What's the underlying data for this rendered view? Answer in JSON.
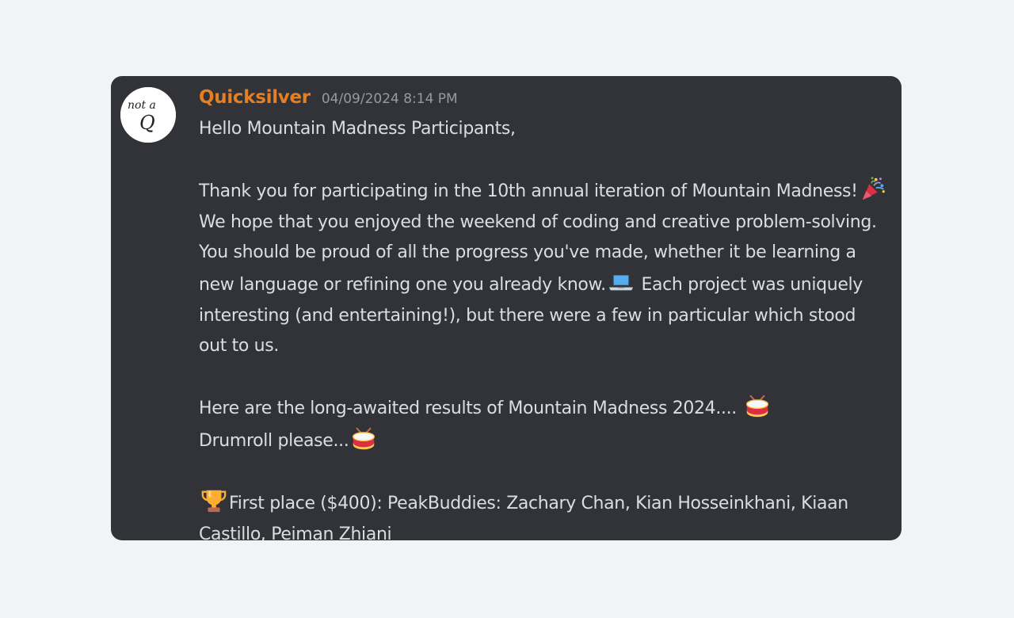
{
  "message": {
    "author": "Quicksilver",
    "timestamp": "04/09/2024 8:14 PM",
    "author_color": "#e67e22",
    "avatar_text_top": "not a",
    "avatar_text_bottom": "Q",
    "greeting": "Hello Mountain Madness Participants,",
    "para1_a": "Thank you for participating in the 10th annual iteration of Mountain Madness!",
    "para1_b": " We hope that you enjoyed the weekend of coding and creative problem-solving. You should be proud of all the progress you've made, whether it be learning a new language or refining one you already know.",
    "para1_c": " Each project was uniquely interesting (and entertaining!), but there were a few in particular which stood out to us.",
    "para2_a": "Here are the long-awaited results of Mountain Madness 2024....",
    "para2_b": "Drumroll please...",
    "first_place": "First place ($400): PeakBuddies: Zachary Chan, Kian Hosseinkhani, Kiaan Castillo, Peiman Zhiani",
    "emojis": [
      "party-popper-icon",
      "laptop-icon",
      "drum-icon",
      "trophy-icon"
    ]
  },
  "colors": {
    "background": "#f2f3f5",
    "card": "#313338",
    "text": "#dbdee1",
    "timestamp": "#949ba4"
  }
}
